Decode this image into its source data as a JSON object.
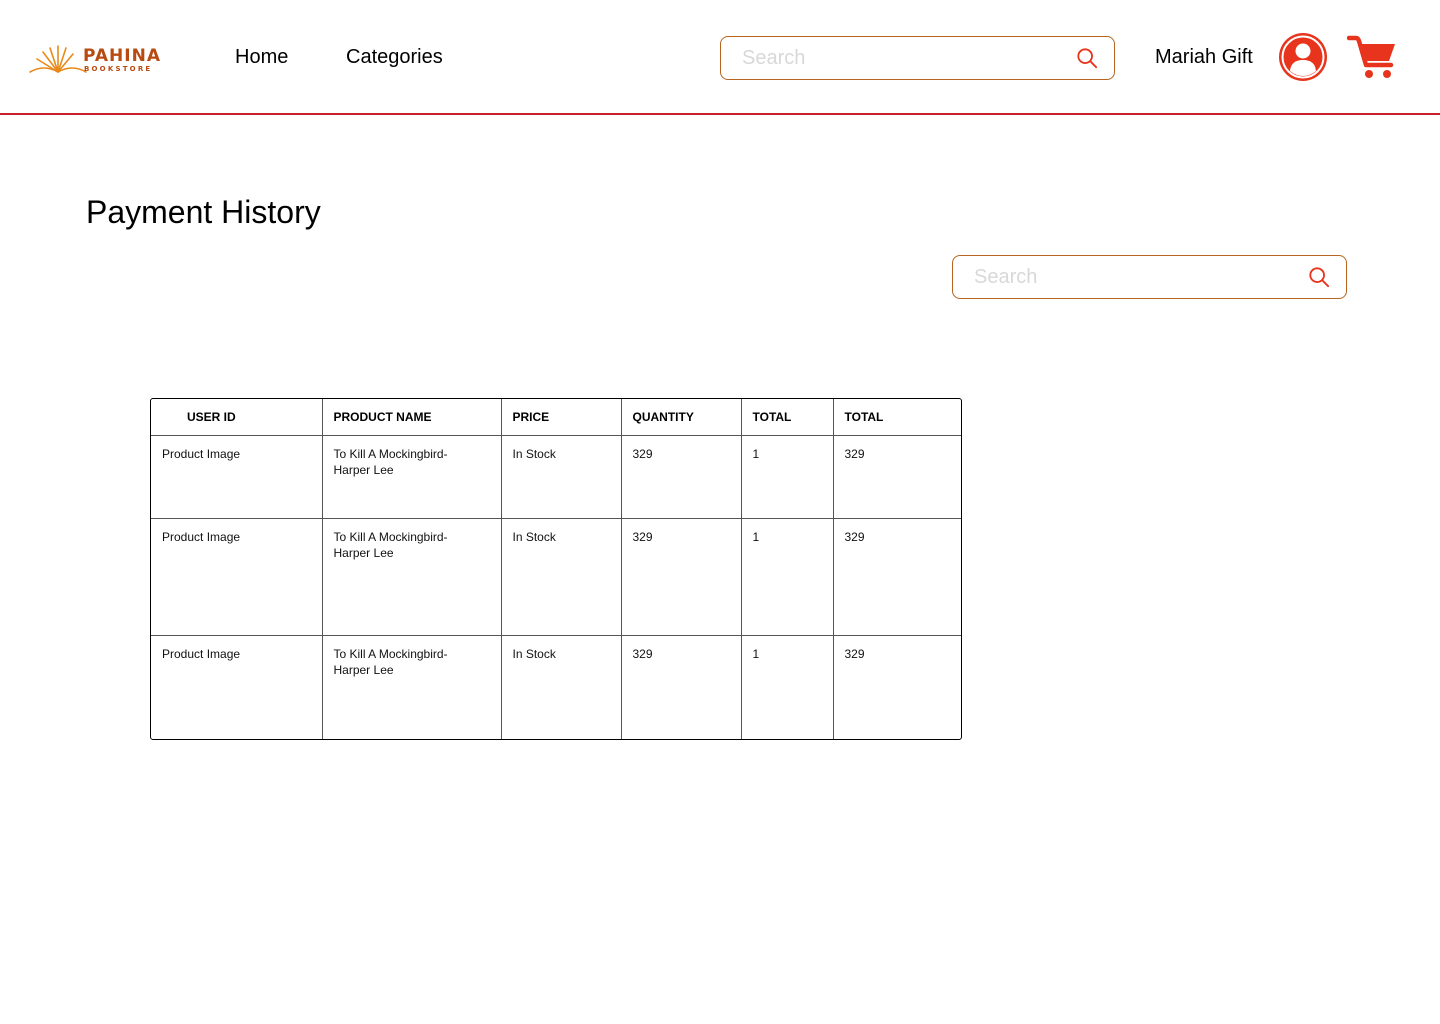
{
  "brand": {
    "name": "PAHINA",
    "tagline": "BOOKSTORE",
    "color": "#b84a12",
    "accent": "#e88a1a"
  },
  "nav": {
    "home": "Home",
    "categories": "Categories"
  },
  "header": {
    "search_placeholder": "Search",
    "user_name": "Mariah Gift",
    "avatar_icon": "user-avatar-icon",
    "cart_icon": "shopping-cart-icon",
    "icon_color": "#e8341c",
    "divider_color": "#c8202a"
  },
  "main": {
    "title": "Payment History",
    "search_placeholder": "Search"
  },
  "table": {
    "headers": [
      "USER ID",
      "PRODUCT NAME",
      "PRICE",
      "QUANTITY",
      "TOTAL",
      "TOTAL"
    ],
    "rows": [
      [
        "Product Image",
        "To Kill A Mockingbird-\nHarper Lee",
        "In Stock",
        "329",
        "1",
        "329"
      ],
      [
        "Product Image",
        "To Kill A Mockingbird-\nHarper Lee",
        "In Stock",
        "329",
        "1",
        "329"
      ],
      [
        "Product Image",
        "To Kill A Mockingbird-\nHarper Lee",
        "In Stock",
        "329",
        "1",
        "329"
      ]
    ]
  }
}
